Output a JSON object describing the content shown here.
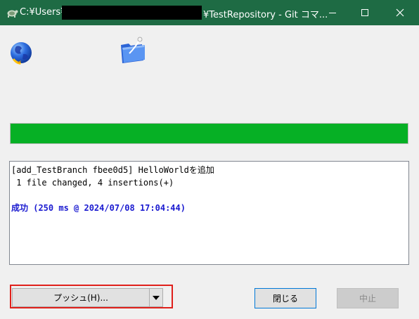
{
  "window": {
    "title_prefix": "C:¥Users¥",
    "title_suffix": "¥TestRepository - Git コマ..."
  },
  "icons": {
    "app": "tortoise-git-icon",
    "globe": "globe-icon",
    "folder": "folder-icon"
  },
  "progress": {
    "value": 1.0
  },
  "log": {
    "lines": [
      "[add_TestBranch fbee0d5] HelloWorldを追加",
      " 1 file changed, 4 insertions(+)",
      "",
      "成功 (250 ms @ 2024/07/08 17:04:44)"
    ]
  },
  "buttons": {
    "push": "プッシュ(H)...",
    "close": "閉じる",
    "abort": "中止"
  },
  "colors": {
    "titlebar": "#1e6b44",
    "progress": "#06b025",
    "success_text": "#1a1ad0",
    "highlight": "#e0201b"
  }
}
